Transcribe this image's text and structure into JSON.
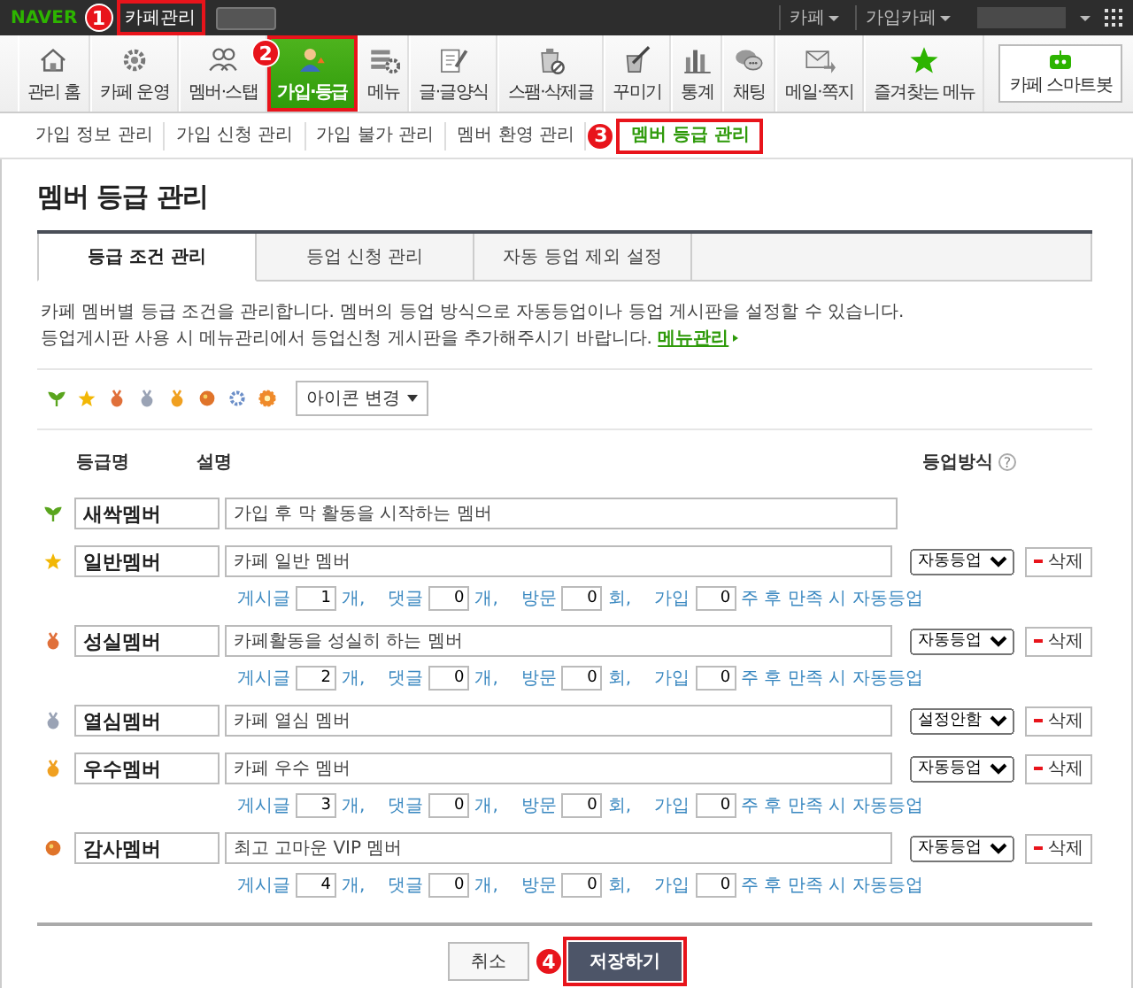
{
  "top_bar": {
    "logo": "NAVER",
    "title": "카페관리",
    "annotation": "1",
    "links": [
      {
        "label": "카페"
      },
      {
        "label": "가입카페"
      }
    ]
  },
  "menu": {
    "items": [
      {
        "label": "관리 홈",
        "selected": false
      },
      {
        "label": "카페 운영",
        "selected": false
      },
      {
        "label": "멤버·스탭",
        "selected": false
      },
      {
        "label": "가입·등급",
        "selected": true,
        "annotation": "2"
      },
      {
        "label": "메뉴",
        "selected": false
      },
      {
        "label": "글·글양식",
        "selected": false
      },
      {
        "label": "스팸·삭제글",
        "selected": false
      },
      {
        "label": "꾸미기",
        "selected": false
      },
      {
        "label": "통계",
        "selected": false
      },
      {
        "label": "채팅",
        "selected": false
      },
      {
        "label": "메일·쪽지",
        "selected": false
      },
      {
        "label": "즐겨찾는 메뉴",
        "selected": false
      }
    ],
    "bot_button": "카페 스마트봇"
  },
  "sub_nav": [
    {
      "label": "가입 정보 관리",
      "selected": false
    },
    {
      "label": "가입 신청 관리",
      "selected": false
    },
    {
      "label": "가입 불가 관리",
      "selected": false
    },
    {
      "label": "멤버 환영 관리",
      "selected": false
    },
    {
      "label": "멤버 등급 관리",
      "selected": true,
      "annotation": "3"
    }
  ],
  "panel": {
    "title": "멤버 등급 관리",
    "tabs": [
      {
        "label": "등급 조건 관리",
        "selected": true
      },
      {
        "label": "등업 신청 관리",
        "selected": false
      },
      {
        "label": "자동 등업 제외 설정",
        "selected": false
      }
    ],
    "notice": {
      "lines": [
        "카페 멤버별 등급 조건을 관리합니다. 멤버의 등업 방식으로 자동등업이나 등업 게시판을 설정할 수 있습니다.",
        "등업게시판 사용 시 메뉴관리에서 등업신청 게시판을 추가해주시기 바랍니다."
      ],
      "link": "메뉴관리"
    },
    "grade_icons": [
      {
        "kind": "sprout",
        "color": "#5aa51e"
      },
      {
        "kind": "star",
        "color": "#f2b705"
      },
      {
        "kind": "medal",
        "color": "#e0703a"
      },
      {
        "kind": "medal",
        "color": "#9aa3b5"
      },
      {
        "kind": "medal",
        "color": "#f0a020"
      },
      {
        "kind": "ball",
        "color": "#e0742a"
      },
      {
        "kind": "gear",
        "color": "#6c8fc8"
      },
      {
        "kind": "flower",
        "color": "#ef8a2a"
      }
    ],
    "icon_button": "아이콘 변경",
    "columns": {
      "name": "등급명",
      "description": "설명",
      "method": "등업방식",
      "help": "?"
    },
    "grades": [
      {
        "icon": {
          "kind": "sprout",
          "color": "#5aa51e"
        },
        "name": "새싹멤버",
        "description": "가입 후 막 활동을 시작하는 멤버"
      },
      {
        "icon": {
          "kind": "star",
          "color": "#f2b705"
        },
        "name": "일반멤버",
        "description": "카페 일반 멤버",
        "method": "자동등업",
        "delete": "삭제",
        "conditions": [
          {
            "label": "게시글",
            "value": "1",
            "unit": "개,"
          },
          {
            "label": "댓글",
            "value": "0",
            "unit": "개,"
          },
          {
            "label": "방문",
            "value": "0",
            "unit": "회,"
          },
          {
            "label": "가입",
            "value": "0",
            "unit": "주 후 만족 시 자동등업"
          }
        ]
      },
      {
        "icon": {
          "kind": "medal",
          "color": "#e0703a"
        },
        "name": "성실멤버",
        "description": "카페활동을 성실히 하는 멤버",
        "method": "자동등업",
        "delete": "삭제",
        "conditions": [
          {
            "label": "게시글",
            "value": "2",
            "unit": "개,"
          },
          {
            "label": "댓글",
            "value": "0",
            "unit": "개,"
          },
          {
            "label": "방문",
            "value": "0",
            "unit": "회,"
          },
          {
            "label": "가입",
            "value": "0",
            "unit": "주 후 만족 시 자동등업"
          }
        ]
      },
      {
        "icon": {
          "kind": "medal",
          "color": "#9aa3b5"
        },
        "name": "열심멤버",
        "description": "카페 열심 멤버",
        "method": "설정안함",
        "delete": "삭제"
      },
      {
        "icon": {
          "kind": "medal",
          "color": "#f0a020"
        },
        "name": "우수멤버",
        "description": "카페 우수 멤버",
        "method": "자동등업",
        "delete": "삭제",
        "conditions": [
          {
            "label": "게시글",
            "value": "3",
            "unit": "개,"
          },
          {
            "label": "댓글",
            "value": "0",
            "unit": "개,"
          },
          {
            "label": "방문",
            "value": "0",
            "unit": "회,"
          },
          {
            "label": "가입",
            "value": "0",
            "unit": "주 후 만족 시 자동등업"
          }
        ]
      },
      {
        "icon": {
          "kind": "ball",
          "color": "#e0742a"
        },
        "name": "감사멤버",
        "description": "최고 고마운 VIP 멤버",
        "method": "자동등업",
        "delete": "삭제",
        "conditions": [
          {
            "label": "게시글",
            "value": "4",
            "unit": "개,"
          },
          {
            "label": "댓글",
            "value": "0",
            "unit": "개,"
          },
          {
            "label": "방문",
            "value": "0",
            "unit": "회,"
          },
          {
            "label": "가입",
            "value": "0",
            "unit": "주 후 만족 시 자동등업"
          }
        ]
      }
    ],
    "buttons": {
      "cancel": "취소",
      "save": "저장하기",
      "save_annotation": "4"
    }
  }
}
